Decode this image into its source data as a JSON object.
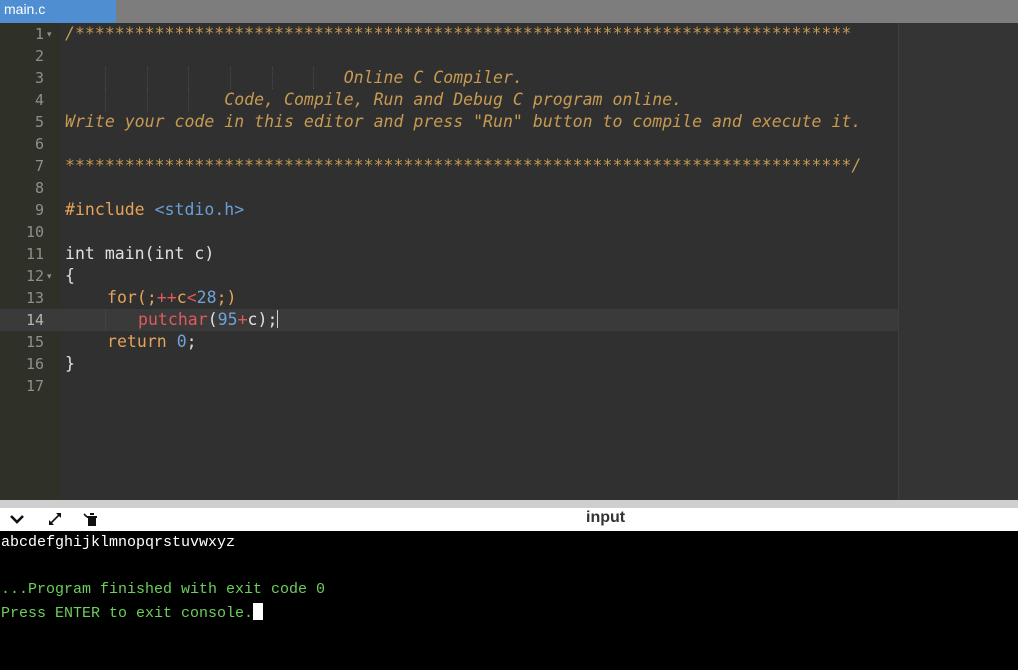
{
  "tab": {
    "filename": "main.c"
  },
  "editor": {
    "lines": [
      {
        "n": "1",
        "fold": true
      },
      {
        "n": "2"
      },
      {
        "n": "3"
      },
      {
        "n": "4"
      },
      {
        "n": "5"
      },
      {
        "n": "6"
      },
      {
        "n": "7"
      },
      {
        "n": "8"
      },
      {
        "n": "9"
      },
      {
        "n": "10"
      },
      {
        "n": "11"
      },
      {
        "n": "12",
        "fold": true
      },
      {
        "n": "13"
      },
      {
        "n": "14",
        "active": true
      },
      {
        "n": "15"
      },
      {
        "n": "16"
      },
      {
        "n": "17"
      }
    ],
    "code": {
      "l1": "/******************************************************************************",
      "l3": "                            Online C Compiler.",
      "l4": "                Code, Compile, Run and Debug C program online.",
      "l5": "Write your code in this editor and press \"Run\" button to compile and execute it.",
      "l7": "*******************************************************************************/",
      "l9_directive": "#include",
      "l9_header": "<stdio.h>",
      "l11": "int main(int c)",
      "l12": "{",
      "l13_for": "for",
      "l13_a": "(;",
      "l13_op": "++",
      "l13_b": "c",
      "l13_lt": "<",
      "l13_num": "28",
      "l13_c": ";)",
      "l14_fn": "putchar",
      "l14_a": "(",
      "l14_num": "95",
      "l14_plus": "+",
      "l14_b": "c);",
      "l15_kw": "return",
      "l15_num": "0",
      "l15_end": ";",
      "l16": "}"
    }
  },
  "console_bar": {
    "input_label": "input",
    "icons": [
      "chevron-down-icon",
      "expand-icon",
      "clear-console-icon"
    ]
  },
  "console": {
    "output": "abcdefghijklmnopqrstuvwxyz",
    "finished": "...Program finished with exit code 0",
    "press_enter": "Press ENTER to exit console."
  },
  "colors": {
    "tab_bg": "#4f8fd1",
    "editor_bg": "#303030",
    "comment": "#c79a52",
    "console_bg": "#000000",
    "console_green": "#6ccf5b"
  }
}
